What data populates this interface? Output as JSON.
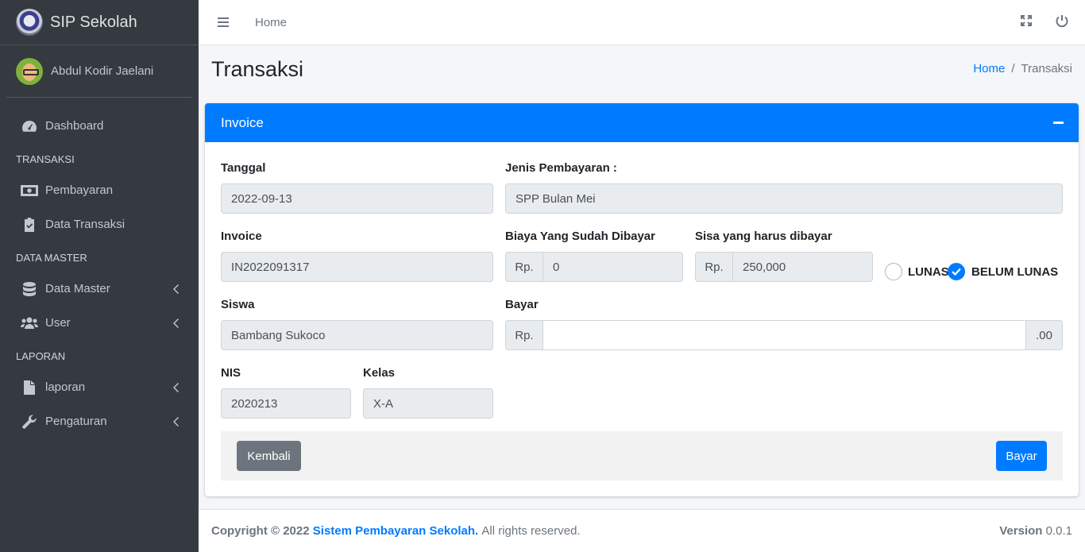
{
  "brand": {
    "name": "SIP Sekolah"
  },
  "user": {
    "name": "Abdul Kodir Jaelani"
  },
  "sidebar": {
    "dashboard": "Dashboard",
    "header_transaksi": "TRANSAKSI",
    "pembayaran": "Pembayaran",
    "data_transaksi": "Data Transaksi",
    "header_master": "DATA MASTER",
    "data_master": "Data Master",
    "user": "User",
    "header_laporan": "LAPORAN",
    "laporan": "laporan",
    "pengaturan": "Pengaturan"
  },
  "topbar": {
    "home": "Home"
  },
  "page": {
    "title": "Transaksi"
  },
  "breadcrumb": {
    "home": "Home",
    "sep": "/",
    "current": "Transaksi"
  },
  "card": {
    "title": "Invoice"
  },
  "form": {
    "tanggal": {
      "label": "Tanggal",
      "value": "2022-09-13"
    },
    "jenis": {
      "label": "Jenis Pembayaran :",
      "value": "SPP Bulan Mei"
    },
    "invoice": {
      "label": "Invoice",
      "value": "IN2022091317"
    },
    "sudah": {
      "label": "Biaya Yang Sudah Dibayar",
      "prefix": "Rp.",
      "value": "0"
    },
    "sisa": {
      "label": "Sisa yang harus dibayar",
      "prefix": "Rp.",
      "value": "250,000"
    },
    "status": {
      "lunas": "LUNAS",
      "belum": "BELUM LUNAS",
      "selected": "BELUM LUNAS"
    },
    "siswa": {
      "label": "Siswa",
      "value": "Bambang Sukoco"
    },
    "bayar": {
      "label": "Bayar",
      "prefix": "Rp.",
      "suffix": ".00",
      "value": ""
    },
    "nis": {
      "label": "NIS",
      "value": "2020213"
    },
    "kelas": {
      "label": "Kelas",
      "value": "X-A"
    }
  },
  "buttons": {
    "back": "Kembali",
    "pay": "Bayar"
  },
  "footer": {
    "copyright": "Copyright © 2022",
    "app_name": "Sistem Pembayaran Sekolah.",
    "rights": "All rights reserved.",
    "version_label": "Version",
    "version": "0.0.1"
  },
  "colors": {
    "primary": "#007bff",
    "sidebar": "#343a40",
    "secondary": "#6c757d"
  }
}
